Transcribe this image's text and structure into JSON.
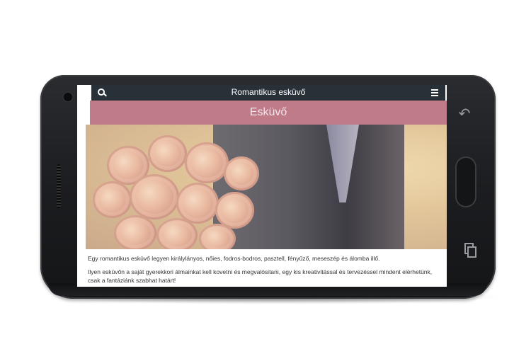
{
  "app": {
    "title": "Romantikus esküvő",
    "search_icon": "search-icon",
    "menu_icon": "hamburger-menu-icon"
  },
  "page": {
    "heading": "Esküvő",
    "paragraphs": [
      "Egy romantikus esküvő legyen királylányos, nőies, fodros-bodros, pasztell, fényűző, meseszép és álomba illő.",
      "Ilyen esküvőn a saját gyerekkori álmainkat kell kovetni és megvalósitani, egy kis kreativitással és tervezéssel mindent elérhetünk, csak a fantáziánk szabhat határt!"
    ]
  },
  "device": {
    "back_icon": "back-icon",
    "recent_icon": "recent-apps-icon"
  },
  "colors": {
    "topbar": "#283038",
    "band": "#c07b88"
  }
}
